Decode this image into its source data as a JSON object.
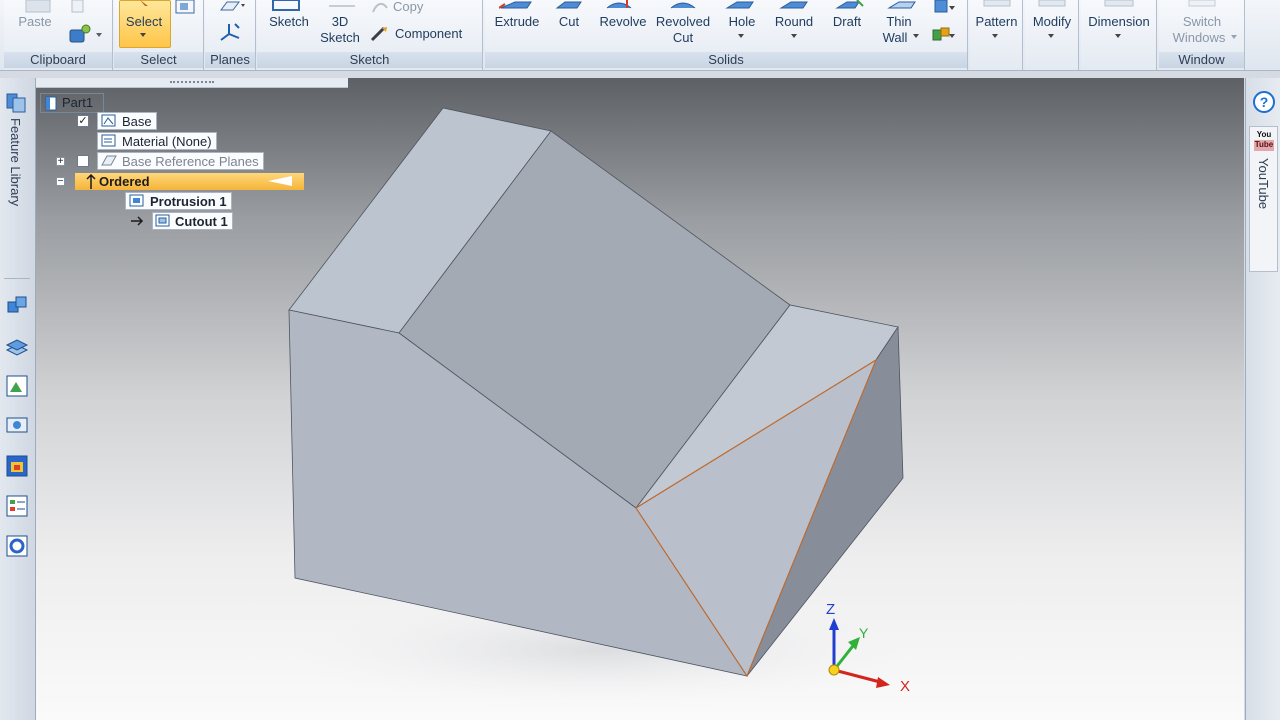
{
  "ribbon": {
    "clipboard": {
      "label": "Clipboard",
      "paste": "Paste"
    },
    "select": {
      "label": "Select",
      "select_button": "Select"
    },
    "planes": {
      "label": "Planes"
    },
    "sketch": {
      "label": "Sketch",
      "sketch_button": "Sketch",
      "sketch3d_line1": "3D",
      "sketch3d_line2": "Sketch",
      "copy": "Copy",
      "component": "Component"
    },
    "solids": {
      "label": "Solids",
      "extrude": "Extrude",
      "cut": "Cut",
      "revolve": "Revolve",
      "revolved_cut_line1": "Revolved",
      "revolved_cut_line2": "Cut",
      "hole": "Hole",
      "round": "Round",
      "draft": "Draft",
      "thin_wall_line1": "Thin",
      "thin_wall_line2": "Wall"
    },
    "pattern": {
      "label": "Pattern"
    },
    "modify": {
      "label": "Modify"
    },
    "dimension": {
      "label": "Dimension"
    },
    "window": {
      "label": "Window",
      "switch_line1": "Switch",
      "switch_line2": "Windows"
    }
  },
  "leftbar": {
    "feature_library": "Feature Library"
  },
  "rightbar": {
    "youtube_badge": "You Tube",
    "youtube": "YouTube"
  },
  "tree": {
    "root": "Part1",
    "base": "Base",
    "material": "Material (None)",
    "base_reference_planes": "Base Reference Planes",
    "ordered": "Ordered",
    "protrusion": "Protrusion 1",
    "cutout": "Cutout 1"
  },
  "triad": {
    "x": "X",
    "y": "Y",
    "z": "Z"
  },
  "colors": {
    "accent_orange": "#f5b43a",
    "edge_orange": "#c46a2a",
    "ribbon_text": "#1f3b5e"
  }
}
